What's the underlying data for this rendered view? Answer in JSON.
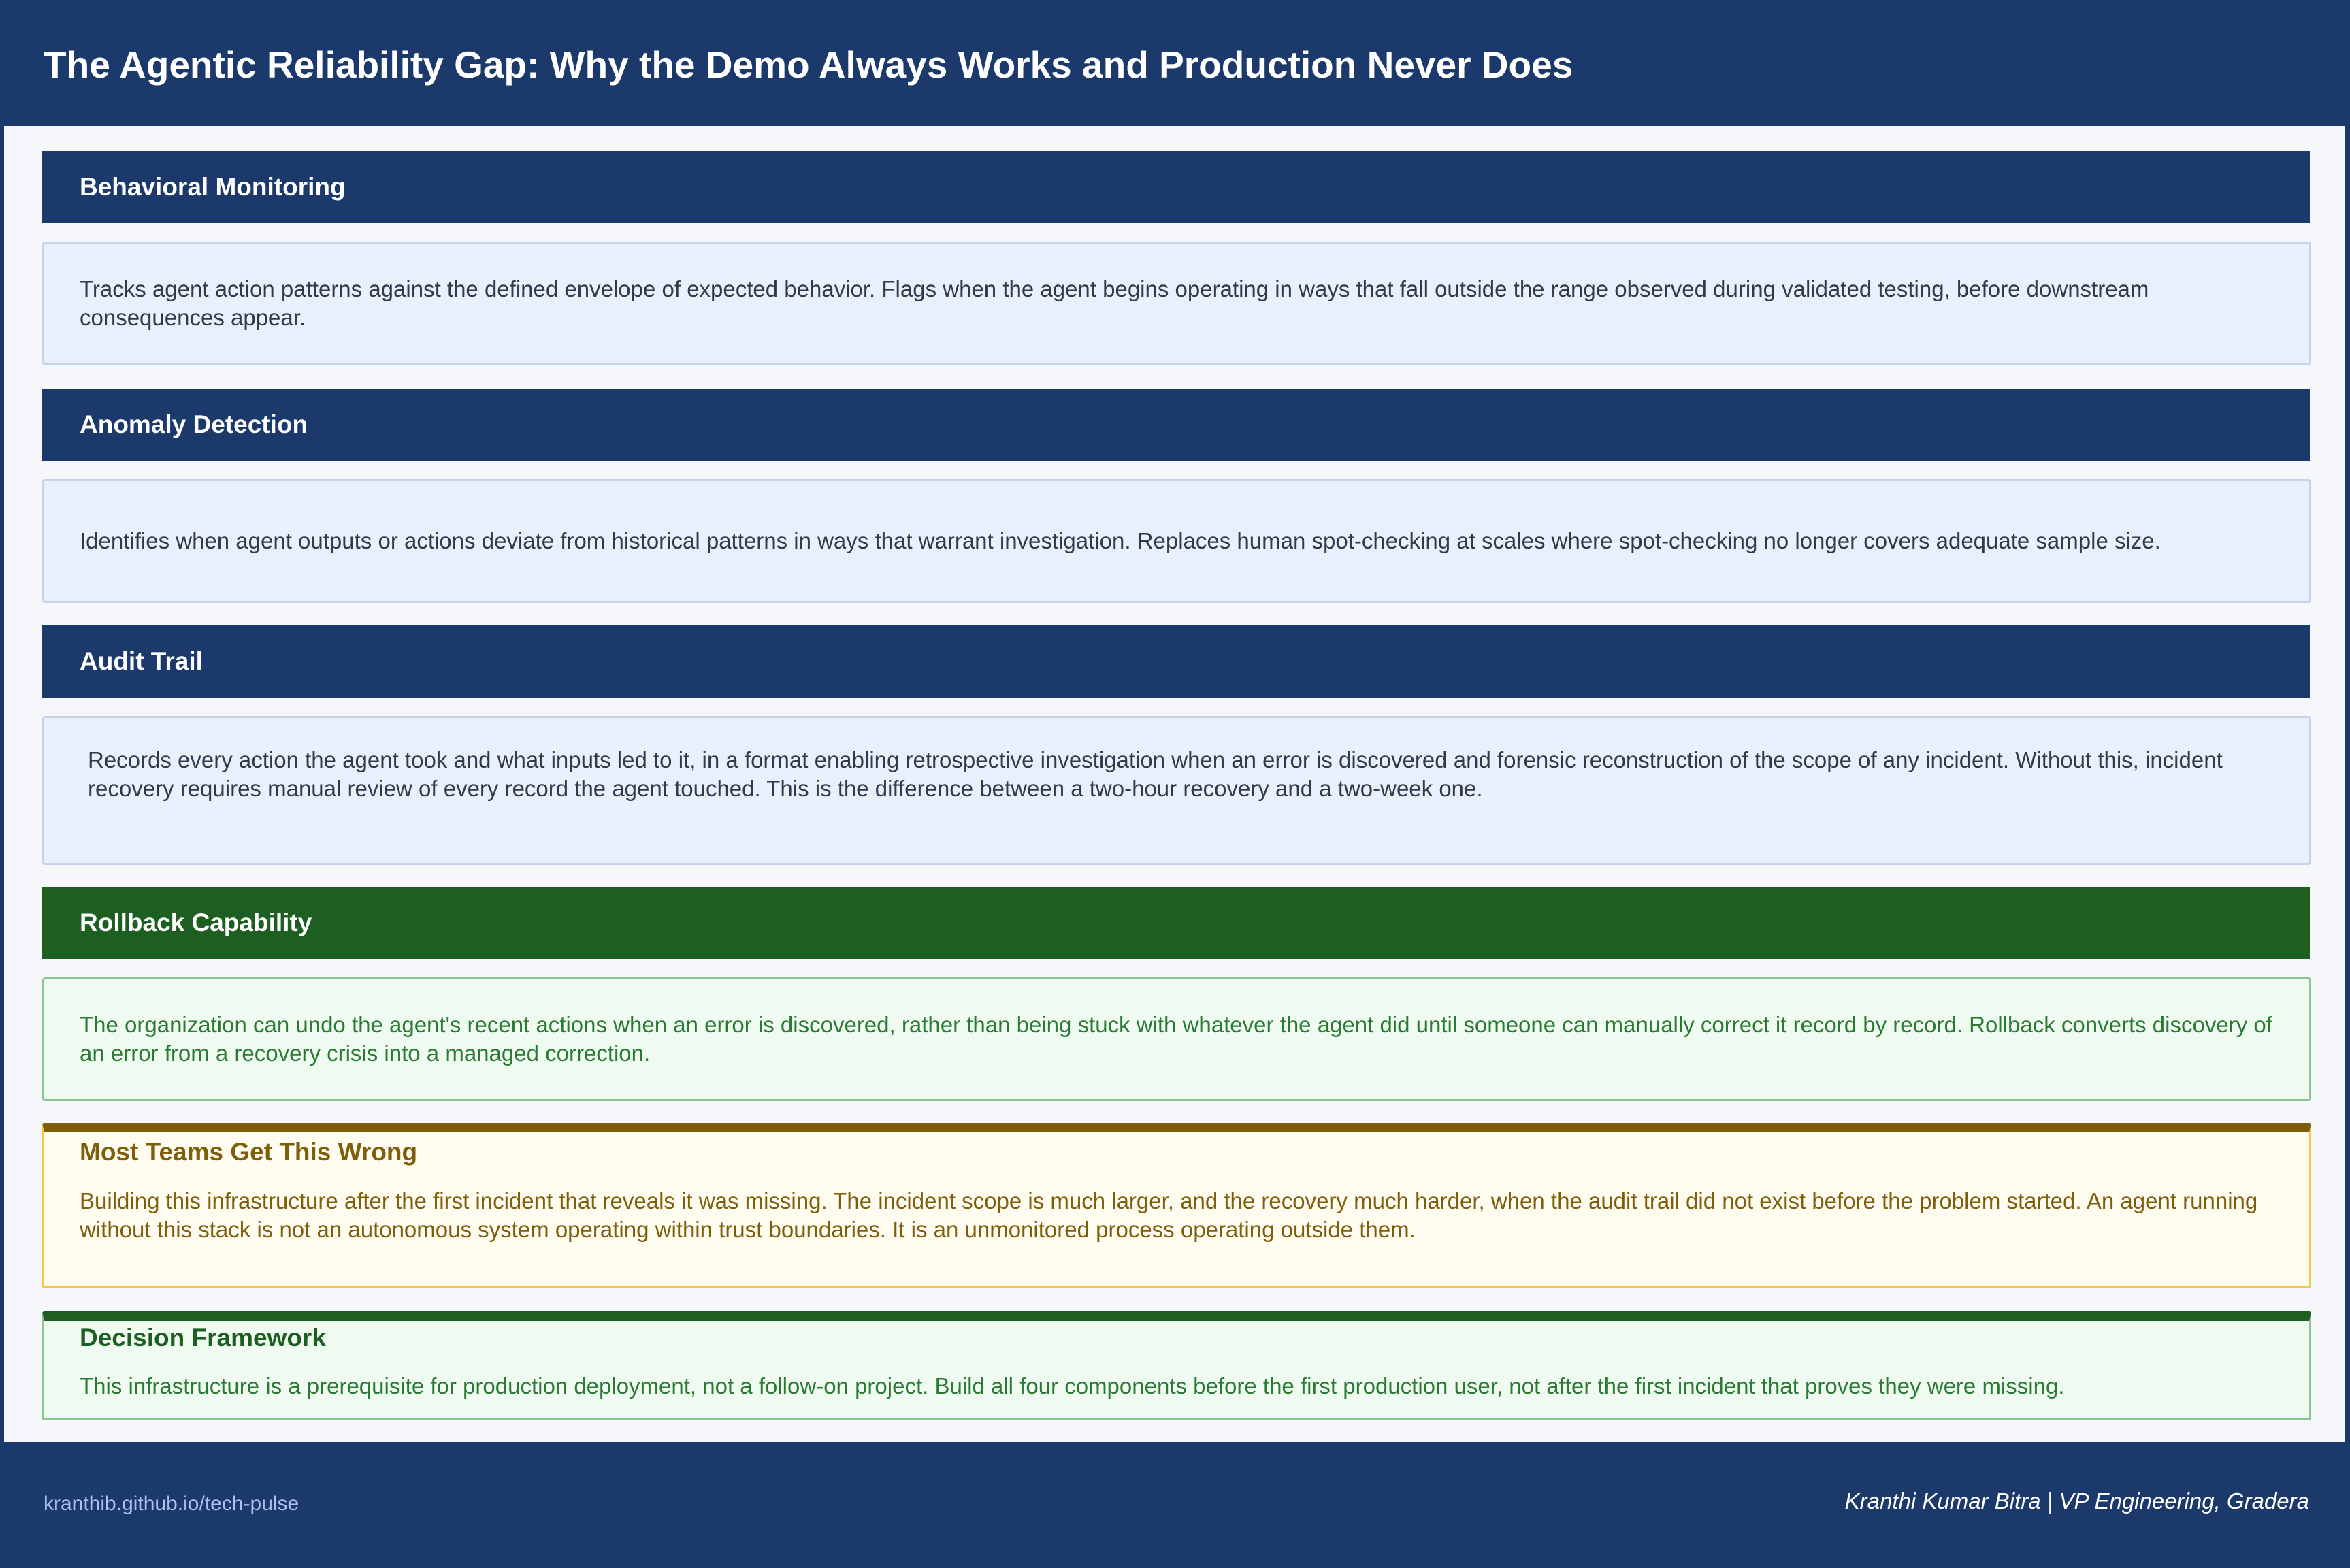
{
  "header": {
    "title": "The Agentic Reliability Gap: Why the Demo Always Works and Production Never Does"
  },
  "sections": [
    {
      "title": "Behavioral Monitoring",
      "text": "Tracks agent action patterns against the defined envelope of expected behavior. Flags when the agent begins operating in ways that fall outside the range observed during validated testing, before downstream consequences appear."
    },
    {
      "title": "Anomaly Detection",
      "text": "Identifies when agent outputs or actions deviate from historical patterns in ways that warrant investigation. Replaces human spot-checking at scales where spot-checking no longer covers adequate sample size."
    },
    {
      "title": "Audit Trail",
      "text": "Records every action the agent took and what inputs led to it, in a format enabling retrospective investigation when an error is discovered and forensic reconstruction of the scope of any incident. Without this, incident recovery requires manual review of every record the agent touched. This is the difference between a two-hour recovery and a two-week one."
    },
    {
      "title": "Rollback Capability",
      "text": "The organization can undo the agent's recent actions when an error is discovered, rather than being stuck with whatever the agent did until someone can manually correct it record by record. Rollback converts discovery of an error from a recovery crisis into a managed correction."
    }
  ],
  "warning": {
    "title": "Most Teams Get This Wrong",
    "text": "Building this infrastructure after the first incident that reveals it was missing. The incident scope is much larger, and the recovery much harder, when the audit trail did not exist before the problem started. An agent running without this stack is not an autonomous system operating within trust boundaries. It is an unmonitored process operating outside them."
  },
  "decision": {
    "title": "Decision Framework",
    "text": "This infrastructure is a prerequisite for production deployment, not a follow-on project. Build all four components before the first production user, not after the first incident that proves they were missing."
  },
  "footer": {
    "link": "kranthib.github.io/tech-pulse",
    "author": "Kranthi Kumar Bitra | VP Engineering, Gradera"
  },
  "colors": {
    "navy": "#1b396a",
    "green": "#1d5e21",
    "gold": "#7e5d0b"
  }
}
